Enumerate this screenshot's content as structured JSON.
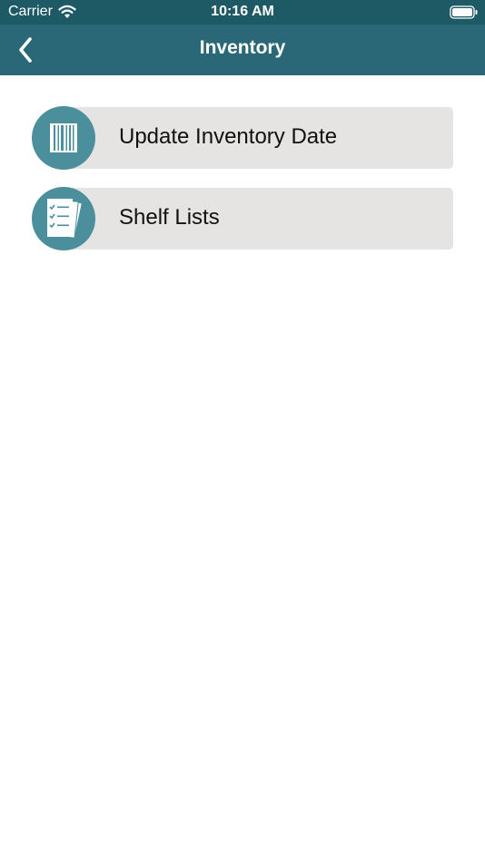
{
  "status_bar": {
    "carrier": "Carrier",
    "time": "10:16 AM",
    "wifi_icon": "wifi-icon",
    "battery_icon": "battery-icon"
  },
  "nav": {
    "title": "Inventory",
    "back_icon": "chevron-left-icon"
  },
  "menu": {
    "items": [
      {
        "label": "Update Inventory Date",
        "icon": "barcode-icon"
      },
      {
        "label": "Shelf Lists",
        "icon": "checklist-icon"
      }
    ]
  },
  "colors": {
    "status_bar": "#1e5a66",
    "nav_bar": "#2b6877",
    "icon_circle": "#4b8f9c",
    "item_background": "#e5e4e3",
    "text": "#111111"
  }
}
